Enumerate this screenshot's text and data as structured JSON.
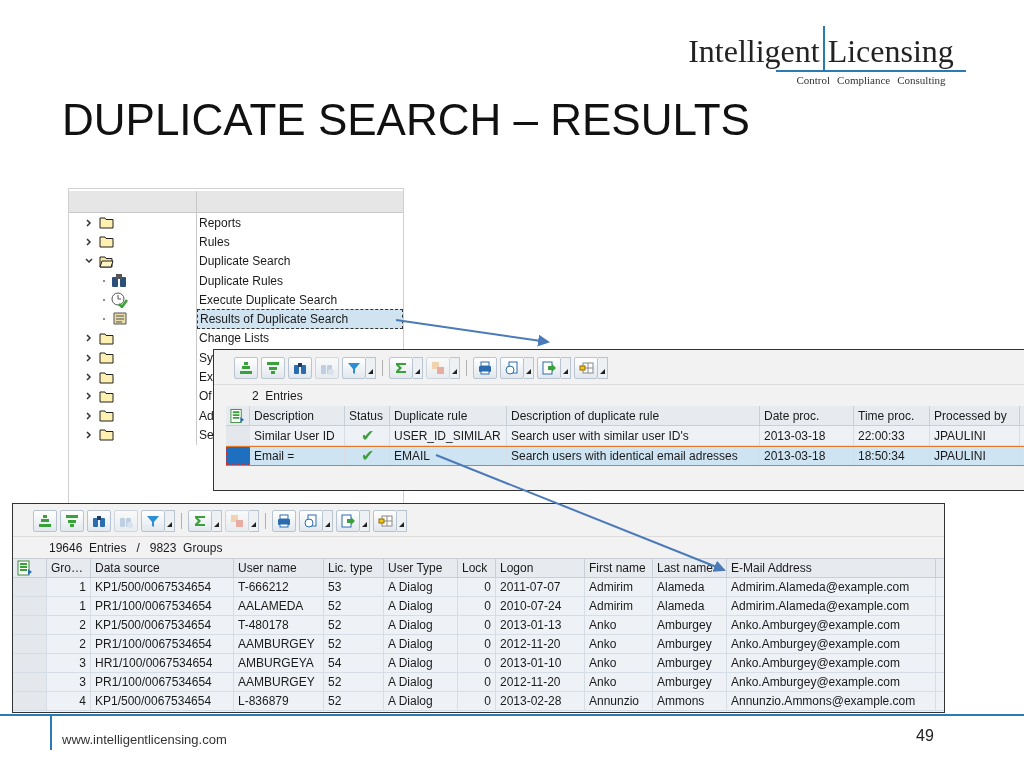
{
  "logo": {
    "word_1": "Intelligent",
    "word_2": "Licensing",
    "tagline": [
      "Control",
      "Compliance",
      "Consulting"
    ]
  },
  "slide": {
    "title": "DUPLICATE SEARCH – RESULTS",
    "footer_url": "www.intelligentlicensing.com",
    "page_number": "49"
  },
  "tree": {
    "items": [
      {
        "label": "Reports",
        "expanded": false,
        "selected": false
      },
      {
        "label": "Rules",
        "expanded": false,
        "selected": false
      },
      {
        "label": "Duplicate Search",
        "expanded": true,
        "selected": false,
        "children": [
          {
            "label": "Duplicate Rules",
            "kind": "binoculars",
            "selected": false
          },
          {
            "label": "Execute Duplicate Search",
            "kind": "clock",
            "selected": false
          },
          {
            "label": "Results of Duplicate Search",
            "kind": "scroll",
            "selected": true
          }
        ]
      },
      {
        "label": "Change Lists",
        "expanded": false,
        "selected": false
      },
      {
        "label": "Sy",
        "expanded": false,
        "selected": false
      },
      {
        "label": "Ex",
        "expanded": false,
        "selected": false
      },
      {
        "label": "Of",
        "expanded": false,
        "selected": false
      },
      {
        "label": "Ad",
        "expanded": false,
        "selected": false
      },
      {
        "label": "Se",
        "expanded": false,
        "selected": false
      }
    ]
  },
  "rules_window": {
    "entries": "2  Entries",
    "columns": [
      "Description",
      "Status",
      "Duplicate rule",
      "Description of duplicate rule",
      "Date proc.",
      "Time proc.",
      "Processed by"
    ],
    "rows": [
      {
        "selected": false,
        "cells": [
          "Similar User ID",
          "✔",
          "USER_ID_SIMILAR",
          "Search user with similar user ID's",
          "2013-03-18",
          "22:00:33",
          "JPAULINI"
        ]
      },
      {
        "selected": true,
        "cells": [
          "Email =",
          "✔",
          "EMAIL",
          "Search users with identical email adresses",
          "2013-03-18",
          "18:50:34",
          "JPAULINI"
        ]
      }
    ]
  },
  "results_window": {
    "summary": "19646  Entries   /   9823  Groups",
    "columns": [
      "Gro…",
      "Data source",
      "User name",
      "Lic. type",
      "User Type",
      "Lock",
      "Logon",
      "First name",
      "Last name",
      "E-Mail Address"
    ],
    "rows": [
      {
        "cells": [
          "1",
          "KP1/500/0067534654",
          "T-666212",
          "53",
          "A Dialog",
          "0",
          "2011-07-07",
          "Admirim",
          "Alameda",
          "Admirim.Alameda@example.com"
        ]
      },
      {
        "cells": [
          "1",
          "PR1/100/0067534654",
          "AALAMEDA",
          "52",
          "A Dialog",
          "0",
          "2010-07-24",
          "Admirim",
          "Alameda",
          "Admirim.Alameda@example.com"
        ]
      },
      {
        "cells": [
          "2",
          "KP1/500/0067534654",
          "T-480178",
          "52",
          "A Dialog",
          "0",
          "2013-01-13",
          "Anko",
          "Amburgey",
          "Anko.Amburgey@example.com"
        ]
      },
      {
        "cells": [
          "2",
          "PR1/100/0067534654",
          "AAMBURGEY",
          "52",
          "A Dialog",
          "0",
          "2012-11-20",
          "Anko",
          "Amburgey",
          "Anko.Amburgey@example.com"
        ]
      },
      {
        "cells": [
          "3",
          "HR1/100/0067534654",
          "AMBURGEYA",
          "54",
          "A Dialog",
          "0",
          "2013-01-10",
          "Anko",
          "Amburgey",
          "Anko.Amburgey@example.com"
        ]
      },
      {
        "cells": [
          "3",
          "PR1/100/0067534654",
          "AAMBURGEY",
          "52",
          "A Dialog",
          "0",
          "2012-11-20",
          "Anko",
          "Amburgey",
          "Anko.Amburgey@example.com"
        ]
      },
      {
        "cells": [
          "4",
          "KP1/500/0067534654",
          "L-836879",
          "52",
          "A Dialog",
          "0",
          "2013-02-28",
          "Annunzio",
          "Ammons",
          "Annunzio.Ammons@example.com"
        ]
      }
    ]
  }
}
